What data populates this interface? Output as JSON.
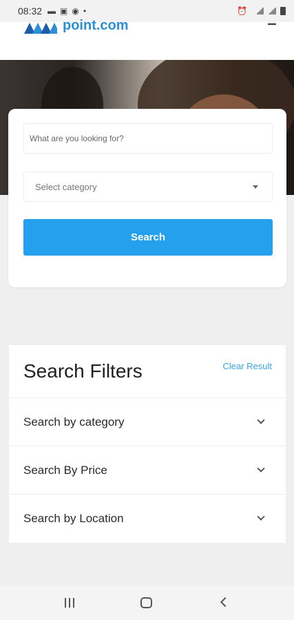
{
  "status_bar": {
    "time": "08:32",
    "icons": [
      "message-icon",
      "gallery-icon",
      "whatsapp-icon",
      "dot-icon",
      "alarm-icon",
      "data-icon",
      "signal-icon",
      "signal-icon",
      "battery-icon"
    ]
  },
  "header": {
    "logo_text": "point.com",
    "menu_icon": "hamburger-icon"
  },
  "search": {
    "placeholder": "What are you looking for?",
    "category_label": "Select category",
    "button_label": "Search"
  },
  "filters": {
    "title": "Search Filters",
    "clear_label": "Clear Result",
    "items": [
      {
        "label": "Search by category"
      },
      {
        "label": "Search By Price"
      },
      {
        "label": "Search by Location"
      }
    ]
  },
  "colors": {
    "accent": "#24a0ec",
    "link": "#3aa3e4",
    "logo": "#2a8fd6"
  }
}
